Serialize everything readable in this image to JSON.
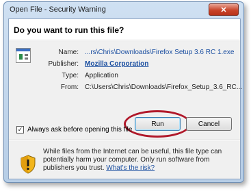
{
  "window": {
    "title": "Open File - Security Warning",
    "close_glyph": "✕"
  },
  "question": "Do you want to run this file?",
  "file": {
    "name_label": "Name:",
    "name_value": "...rs\\Chris\\Downloads\\Firefox Setup 3.6 RC 1.exe",
    "publisher_label": "Publisher:",
    "publisher_value": "Mozilla Corporation",
    "type_label": "Type:",
    "type_value": "Application",
    "from_label": "From:",
    "from_value": "C:\\Users\\Chris\\Downloads\\Firefox_Setup_3.6_RC..."
  },
  "buttons": {
    "run": "Run",
    "cancel": "Cancel"
  },
  "checkbox": {
    "label": "Always ask before opening this file",
    "checked_glyph": "✓"
  },
  "warning": {
    "text": "While files from the Internet can be useful, this file type can potentially harm your computer. Only run software from publishers you trust.",
    "link": "What's the risk?"
  },
  "colors": {
    "highlight": "#b0182a",
    "link": "#1a4ea0"
  }
}
